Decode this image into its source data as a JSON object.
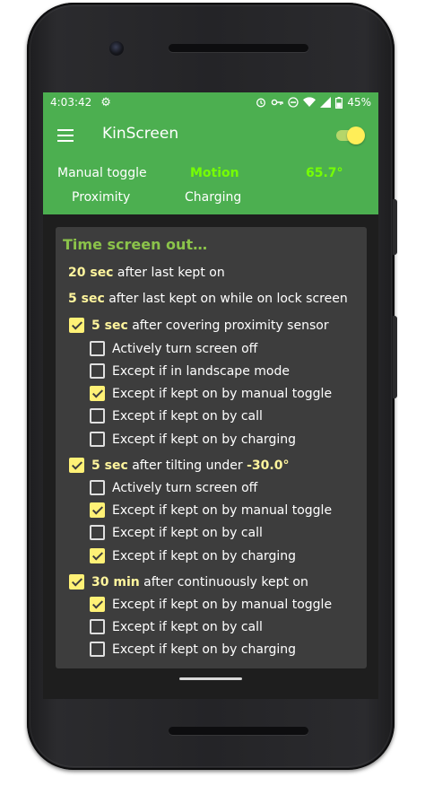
{
  "status": {
    "time": "4:03:42",
    "battery": "45%"
  },
  "appbar": {
    "title": "KinScreen"
  },
  "sensors": {
    "manual_toggle": "Manual toggle",
    "motion": "Motion",
    "angle": "65.7°",
    "proximity": "Proximity",
    "charging": "Charging"
  },
  "card": {
    "title": "Time screen out…",
    "kept_on": {
      "value": "20 sec",
      "text": " after last kept on"
    },
    "lock_screen": {
      "value": "5 sec",
      "text": " after last kept on while on lock screen"
    },
    "proximity": {
      "value": "5 sec",
      "text": " after covering proximity sensor",
      "checked": true,
      "options": [
        {
          "label": "Actively turn screen off",
          "checked": false
        },
        {
          "label": "Except if in landscape mode",
          "checked": false
        },
        {
          "label": "Except if kept on by manual toggle",
          "checked": true
        },
        {
          "label": "Except if kept on by call",
          "checked": false
        },
        {
          "label": "Except if kept on by charging",
          "checked": false
        }
      ]
    },
    "tilt": {
      "value": "5 sec",
      "text": " after tilting under ",
      "angle": "-30.0°",
      "checked": true,
      "options": [
        {
          "label": "Actively turn screen off",
          "checked": false
        },
        {
          "label": "Except if kept on by manual toggle",
          "checked": true
        },
        {
          "label": "Except if kept on by call",
          "checked": false
        },
        {
          "label": "Except if kept on by charging",
          "checked": true
        }
      ]
    },
    "continuous": {
      "value": "30 min",
      "text": " after continuously kept on",
      "checked": true,
      "options": [
        {
          "label": "Except if kept on by manual toggle",
          "checked": true
        },
        {
          "label": "Except if kept on by call",
          "checked": false
        },
        {
          "label": "Except if kept on by charging",
          "checked": false
        }
      ]
    }
  },
  "colors": {
    "appbar": "#4caf50",
    "accent": "#fff176",
    "highlight": "#76ff03",
    "card": "#3d3d3d"
  },
  "icons": [
    "settings-icon",
    "alarm-icon",
    "key-icon",
    "do-not-disturb-icon",
    "wifi-icon",
    "signal-icon",
    "battery-icon",
    "menu-icon"
  ]
}
